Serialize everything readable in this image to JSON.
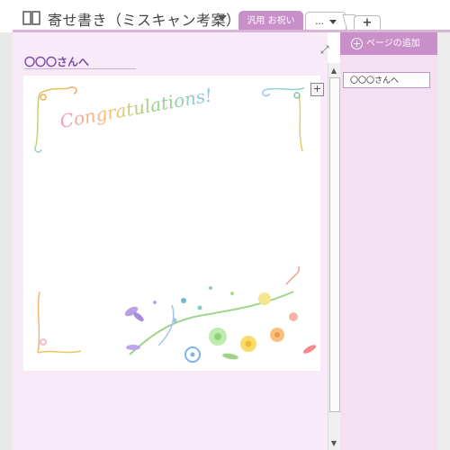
{
  "notebook": {
    "title": "寄せ書き（ミスキャン考案）"
  },
  "tabs": [
    {
      "label": "汎用 お祝い",
      "active": true
    },
    {
      "label": "..."
    },
    {
      "label": "+"
    }
  ],
  "page": {
    "title": "〇〇〇さんへ",
    "card_text": "Congratulations!"
  },
  "pages_pane": {
    "add_page_label": "ページの追加",
    "items": [
      {
        "label": "〇〇〇さんへ"
      }
    ]
  },
  "colors": {
    "accent": "#c98fc9",
    "page_bg": "#f8eaf8",
    "pane_bg": "#f3e1f3",
    "title_text": "#7b4aa4"
  }
}
